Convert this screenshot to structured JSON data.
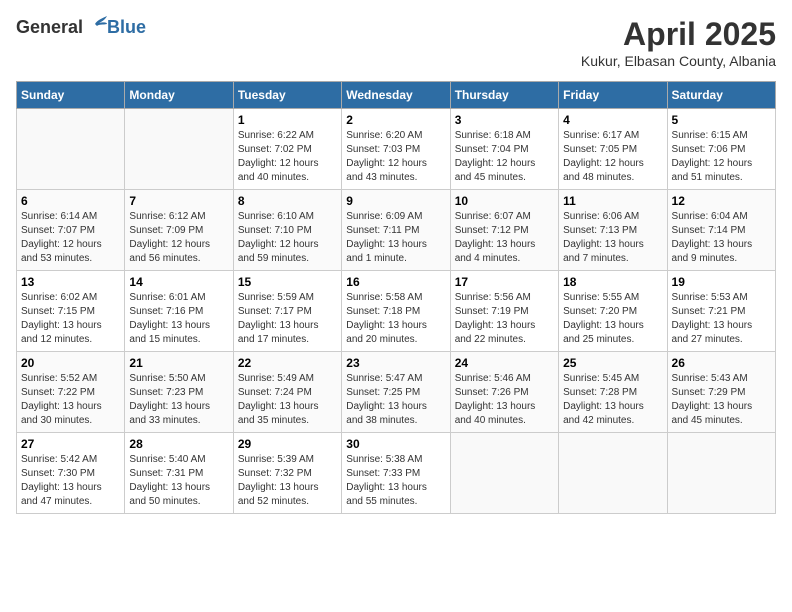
{
  "logo": {
    "general": "General",
    "blue": "Blue"
  },
  "header": {
    "title": "April 2025",
    "subtitle": "Kukur, Elbasan County, Albania"
  },
  "weekdays": [
    "Sunday",
    "Monday",
    "Tuesday",
    "Wednesday",
    "Thursday",
    "Friday",
    "Saturday"
  ],
  "weeks": [
    [
      {
        "day": "",
        "info": ""
      },
      {
        "day": "",
        "info": ""
      },
      {
        "day": "1",
        "sunrise": "Sunrise: 6:22 AM",
        "sunset": "Sunset: 7:02 PM",
        "daylight": "Daylight: 12 hours and 40 minutes."
      },
      {
        "day": "2",
        "sunrise": "Sunrise: 6:20 AM",
        "sunset": "Sunset: 7:03 PM",
        "daylight": "Daylight: 12 hours and 43 minutes."
      },
      {
        "day": "3",
        "sunrise": "Sunrise: 6:18 AM",
        "sunset": "Sunset: 7:04 PM",
        "daylight": "Daylight: 12 hours and 45 minutes."
      },
      {
        "day": "4",
        "sunrise": "Sunrise: 6:17 AM",
        "sunset": "Sunset: 7:05 PM",
        "daylight": "Daylight: 12 hours and 48 minutes."
      },
      {
        "day": "5",
        "sunrise": "Sunrise: 6:15 AM",
        "sunset": "Sunset: 7:06 PM",
        "daylight": "Daylight: 12 hours and 51 minutes."
      }
    ],
    [
      {
        "day": "6",
        "sunrise": "Sunrise: 6:14 AM",
        "sunset": "Sunset: 7:07 PM",
        "daylight": "Daylight: 12 hours and 53 minutes."
      },
      {
        "day": "7",
        "sunrise": "Sunrise: 6:12 AM",
        "sunset": "Sunset: 7:09 PM",
        "daylight": "Daylight: 12 hours and 56 minutes."
      },
      {
        "day": "8",
        "sunrise": "Sunrise: 6:10 AM",
        "sunset": "Sunset: 7:10 PM",
        "daylight": "Daylight: 12 hours and 59 minutes."
      },
      {
        "day": "9",
        "sunrise": "Sunrise: 6:09 AM",
        "sunset": "Sunset: 7:11 PM",
        "daylight": "Daylight: 13 hours and 1 minute."
      },
      {
        "day": "10",
        "sunrise": "Sunrise: 6:07 AM",
        "sunset": "Sunset: 7:12 PM",
        "daylight": "Daylight: 13 hours and 4 minutes."
      },
      {
        "day": "11",
        "sunrise": "Sunrise: 6:06 AM",
        "sunset": "Sunset: 7:13 PM",
        "daylight": "Daylight: 13 hours and 7 minutes."
      },
      {
        "day": "12",
        "sunrise": "Sunrise: 6:04 AM",
        "sunset": "Sunset: 7:14 PM",
        "daylight": "Daylight: 13 hours and 9 minutes."
      }
    ],
    [
      {
        "day": "13",
        "sunrise": "Sunrise: 6:02 AM",
        "sunset": "Sunset: 7:15 PM",
        "daylight": "Daylight: 13 hours and 12 minutes."
      },
      {
        "day": "14",
        "sunrise": "Sunrise: 6:01 AM",
        "sunset": "Sunset: 7:16 PM",
        "daylight": "Daylight: 13 hours and 15 minutes."
      },
      {
        "day": "15",
        "sunrise": "Sunrise: 5:59 AM",
        "sunset": "Sunset: 7:17 PM",
        "daylight": "Daylight: 13 hours and 17 minutes."
      },
      {
        "day": "16",
        "sunrise": "Sunrise: 5:58 AM",
        "sunset": "Sunset: 7:18 PM",
        "daylight": "Daylight: 13 hours and 20 minutes."
      },
      {
        "day": "17",
        "sunrise": "Sunrise: 5:56 AM",
        "sunset": "Sunset: 7:19 PM",
        "daylight": "Daylight: 13 hours and 22 minutes."
      },
      {
        "day": "18",
        "sunrise": "Sunrise: 5:55 AM",
        "sunset": "Sunset: 7:20 PM",
        "daylight": "Daylight: 13 hours and 25 minutes."
      },
      {
        "day": "19",
        "sunrise": "Sunrise: 5:53 AM",
        "sunset": "Sunset: 7:21 PM",
        "daylight": "Daylight: 13 hours and 27 minutes."
      }
    ],
    [
      {
        "day": "20",
        "sunrise": "Sunrise: 5:52 AM",
        "sunset": "Sunset: 7:22 PM",
        "daylight": "Daylight: 13 hours and 30 minutes."
      },
      {
        "day": "21",
        "sunrise": "Sunrise: 5:50 AM",
        "sunset": "Sunset: 7:23 PM",
        "daylight": "Daylight: 13 hours and 33 minutes."
      },
      {
        "day": "22",
        "sunrise": "Sunrise: 5:49 AM",
        "sunset": "Sunset: 7:24 PM",
        "daylight": "Daylight: 13 hours and 35 minutes."
      },
      {
        "day": "23",
        "sunrise": "Sunrise: 5:47 AM",
        "sunset": "Sunset: 7:25 PM",
        "daylight": "Daylight: 13 hours and 38 minutes."
      },
      {
        "day": "24",
        "sunrise": "Sunrise: 5:46 AM",
        "sunset": "Sunset: 7:26 PM",
        "daylight": "Daylight: 13 hours and 40 minutes."
      },
      {
        "day": "25",
        "sunrise": "Sunrise: 5:45 AM",
        "sunset": "Sunset: 7:28 PM",
        "daylight": "Daylight: 13 hours and 42 minutes."
      },
      {
        "day": "26",
        "sunrise": "Sunrise: 5:43 AM",
        "sunset": "Sunset: 7:29 PM",
        "daylight": "Daylight: 13 hours and 45 minutes."
      }
    ],
    [
      {
        "day": "27",
        "sunrise": "Sunrise: 5:42 AM",
        "sunset": "Sunset: 7:30 PM",
        "daylight": "Daylight: 13 hours and 47 minutes."
      },
      {
        "day": "28",
        "sunrise": "Sunrise: 5:40 AM",
        "sunset": "Sunset: 7:31 PM",
        "daylight": "Daylight: 13 hours and 50 minutes."
      },
      {
        "day": "29",
        "sunrise": "Sunrise: 5:39 AM",
        "sunset": "Sunset: 7:32 PM",
        "daylight": "Daylight: 13 hours and 52 minutes."
      },
      {
        "day": "30",
        "sunrise": "Sunrise: 5:38 AM",
        "sunset": "Sunset: 7:33 PM",
        "daylight": "Daylight: 13 hours and 55 minutes."
      },
      {
        "day": "",
        "info": ""
      },
      {
        "day": "",
        "info": ""
      },
      {
        "day": "",
        "info": ""
      }
    ]
  ]
}
